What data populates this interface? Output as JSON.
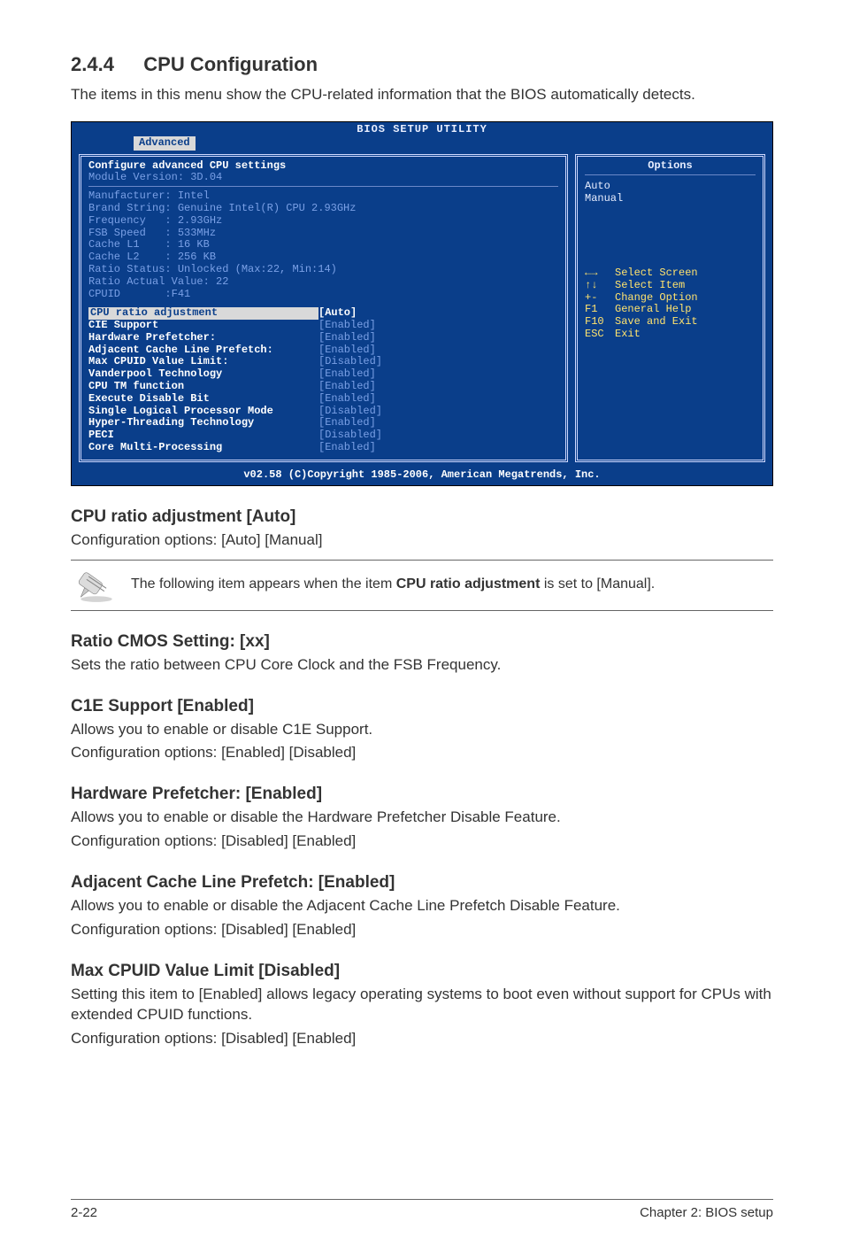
{
  "section": {
    "num": "2.4.4",
    "title": "CPU Configuration"
  },
  "intro": "The items in this menu show the CPU-related information that the BIOS automatically detects.",
  "bios": {
    "header": "BIOS SETUP UTILITY",
    "tab": "Advanced",
    "cfg_title": "Configure advanced CPU settings",
    "module": "Module Version: 3D.04",
    "cpu_info": [
      "Manufacturer: Intel",
      "Brand String: Genuine Intel(R) CPU 2.93GHz",
      "Frequency   : 2.93GHz",
      "FSB Speed   : 533MHz",
      "Cache L1    : 16 KB",
      "Cache L2    : 256 KB",
      "Ratio Status: Unlocked (Max:22, Min:14)",
      "Ratio Actual Value: 22",
      "CPUID       :F41"
    ],
    "items": [
      {
        "label": "CPU ratio adjustment",
        "value": "[Auto]",
        "hl": true
      },
      {
        "label": "CIE Support",
        "value": "[Enabled]",
        "hl": false
      },
      {
        "label": "Hardware Prefetcher:",
        "value": "[Enabled]",
        "hl": false
      },
      {
        "label": "Adjacent Cache Line Prefetch:",
        "value": "[Enabled]",
        "hl": false
      },
      {
        "label": "Max CPUID Value Limit:",
        "value": "[Disabled]",
        "hl": false
      },
      {
        "label": "Vanderpool Technology",
        "value": "[Enabled]",
        "hl": false
      },
      {
        "label": "CPU TM function",
        "value": "[Enabled]",
        "hl": false
      },
      {
        "label": "Execute Disable Bit",
        "value": "[Enabled]",
        "hl": false
      },
      {
        "label": "Single Logical Processor Mode",
        "value": "[Disabled]",
        "hl": false
      },
      {
        "label": "Hyper-Threading Technology",
        "value": "[Enabled]",
        "hl": false
      },
      {
        "label": "PECI",
        "value": "[Disabled]",
        "hl": false
      },
      {
        "label": "Core Multi-Processing",
        "value": "[Enabled]",
        "hl": false
      }
    ],
    "options_title": "Options",
    "options": [
      "Auto",
      "Manual"
    ],
    "nav": [
      {
        "icon": "←→",
        "txt": "Select Screen"
      },
      {
        "icon": "↑↓",
        "txt": "Select Item"
      },
      {
        "icon": "+-",
        "txt": "Change Option"
      },
      {
        "icon": "F1",
        "txt": "General Help"
      },
      {
        "icon": "F10",
        "txt": "Save and Exit"
      },
      {
        "icon": "ESC",
        "txt": "Exit"
      }
    ],
    "footer": "v02.58 (C)Copyright 1985-2006, American Megatrends, Inc."
  },
  "subs": {
    "s1_t": "CPU ratio adjustment [Auto]",
    "s1_p": "Configuration options: [Auto] [Manual]",
    "note_pre": "The following item appears when the item ",
    "note_bold": "CPU ratio adjustment",
    "note_post": " is set to [Manual].",
    "s2_t": "Ratio CMOS Setting: [xx]",
    "s2_p": "Sets the ratio between CPU Core Clock and the FSB Frequency.",
    "s3_t": "C1E Support [Enabled]",
    "s3_p1": "Allows you to enable or disable C1E Support.",
    "s3_p2": "Configuration options: [Enabled] [Disabled]",
    "s4_t": "Hardware Prefetcher: [Enabled]",
    "s4_p1": "Allows you to enable or disable the Hardware Prefetcher Disable Feature.",
    "s4_p2": "Configuration options: [Disabled] [Enabled]",
    "s5_t": "Adjacent Cache Line Prefetch: [Enabled]",
    "s5_p1": "Allows you to enable or disable the Adjacent Cache Line Prefetch Disable Feature.",
    "s5_p2": "Configuration options: [Disabled] [Enabled]",
    "s6_t": "Max CPUID Value Limit [Disabled]",
    "s6_p1": "Setting this item to [Enabled] allows legacy operating systems to boot even without support for CPUs with extended CPUID functions.",
    "s6_p2": "Configuration options: [Disabled] [Enabled]"
  },
  "footer": {
    "left": "2-22",
    "right": "Chapter 2: BIOS setup"
  }
}
